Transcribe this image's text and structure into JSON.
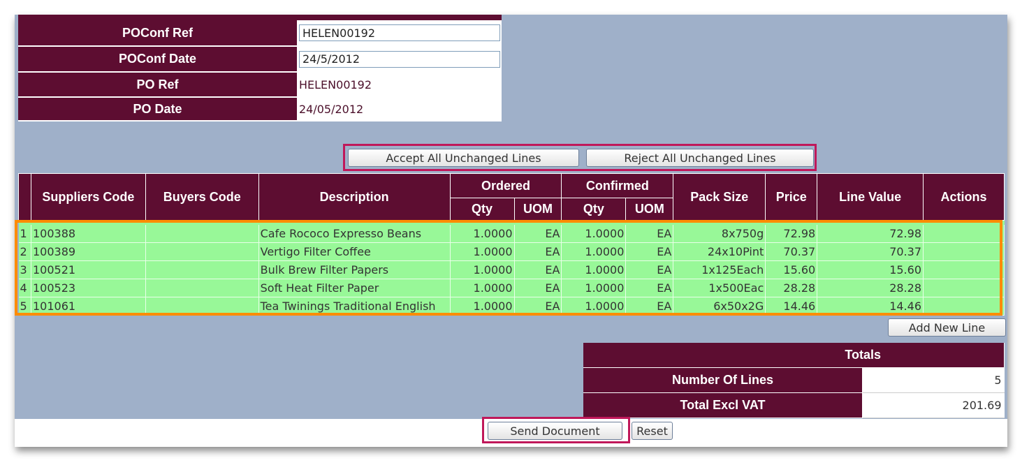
{
  "header": {
    "poconf_ref_label": "POConf Ref",
    "poconf_ref_value": "HELEN00192",
    "poconf_date_label": "POConf Date",
    "poconf_date_value": "24/5/2012",
    "po_ref_label": "PO Ref",
    "po_ref_value": "HELEN00192",
    "po_date_label": "PO Date",
    "po_date_value": "24/05/2012"
  },
  "actions": {
    "accept_all": "Accept All Unchanged Lines",
    "reject_all": "Reject All Unchanged Lines",
    "add_new_line": "Add New Line",
    "send_document": "Send Document",
    "reset": "Reset"
  },
  "table": {
    "headers": {
      "suppliers_code": "Suppliers Code",
      "buyers_code": "Buyers Code",
      "description": "Description",
      "ordered": "Ordered",
      "confirmed": "Confirmed",
      "qty": "Qty",
      "uom": "UOM",
      "pack_size": "Pack Size",
      "price": "Price",
      "line_value": "Line Value",
      "actions": "Actions"
    },
    "rows": [
      {
        "num": "1",
        "supplier_code": "100388",
        "buyer_code": "",
        "description": "Cafe Rococo Expresso Beans",
        "ord_qty": "1.0000",
        "ord_uom": "EA",
        "conf_qty": "1.0000",
        "conf_uom": "EA",
        "pack_size": "8x750g",
        "price": "72.98",
        "line_value": "72.98",
        "actions": ""
      },
      {
        "num": "2",
        "supplier_code": "100389",
        "buyer_code": "",
        "description": "Vertigo Filter Coffee",
        "ord_qty": "1.0000",
        "ord_uom": "EA",
        "conf_qty": "1.0000",
        "conf_uom": "EA",
        "pack_size": "24x10Pint",
        "price": "70.37",
        "line_value": "70.37",
        "actions": ""
      },
      {
        "num": "3",
        "supplier_code": "100521",
        "buyer_code": "",
        "description": "Bulk Brew Filter Papers",
        "ord_qty": "1.0000",
        "ord_uom": "EA",
        "conf_qty": "1.0000",
        "conf_uom": "EA",
        "pack_size": "1x125Each",
        "price": "15.60",
        "line_value": "15.60",
        "actions": ""
      },
      {
        "num": "4",
        "supplier_code": "100523",
        "buyer_code": "",
        "description": "Soft Heat Filter Paper",
        "ord_qty": "1.0000",
        "ord_uom": "EA",
        "conf_qty": "1.0000",
        "conf_uom": "EA",
        "pack_size": "1x500Eac",
        "price": "28.28",
        "line_value": "28.28",
        "actions": ""
      },
      {
        "num": "5",
        "supplier_code": "101061",
        "buyer_code": "",
        "description": "Tea Twinings Traditional English",
        "ord_qty": "1.0000",
        "ord_uom": "EA",
        "conf_qty": "1.0000",
        "conf_uom": "EA",
        "pack_size": "6x50x2G",
        "price": "14.46",
        "line_value": "14.46",
        "actions": ""
      }
    ]
  },
  "totals": {
    "title": "Totals",
    "num_lines_label": "Number Of Lines",
    "num_lines_value": "5",
    "total_excl_vat_label": "Total Excl VAT",
    "total_excl_vat_value": "201.69"
  },
  "colors": {
    "header_bg": "#5d0d31",
    "panel_bg": "#9fb0c9",
    "row_bg": "#98f898",
    "highlight_border": "#c0185a",
    "row_highlight_border": "#ff8c00"
  }
}
